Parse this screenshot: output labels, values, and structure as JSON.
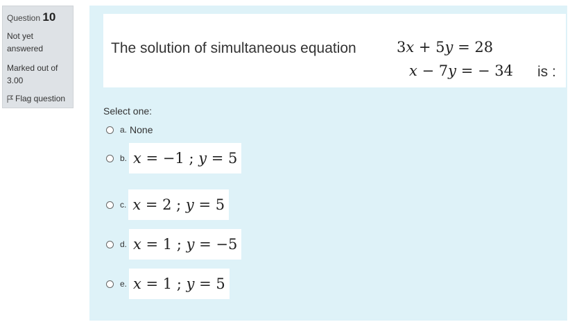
{
  "question_info": {
    "label": "Question",
    "number": "10",
    "state_line1": "Not yet",
    "state_line2": "answered",
    "grade_line1": "Marked out of",
    "grade_line2": "3.00",
    "flag_label": "Flag question",
    "flag_icon": "flag-icon"
  },
  "question": {
    "text": "The solution of simultaneous equation",
    "equation1": "3x + 5y = 28",
    "equation2": "x − 7y = −34",
    "suffix": "is :"
  },
  "answer": {
    "prompt": "Select one:",
    "options": [
      {
        "letter": "a.",
        "text": "None",
        "selected": false
      },
      {
        "letter": "b.",
        "text": "x = −1 ; y = 5",
        "selected": false
      },
      {
        "letter": "c.",
        "text": "x = 2 ; y = 5",
        "selected": false
      },
      {
        "letter": "d.",
        "text": "x = 1 ; y = −5",
        "selected": false
      },
      {
        "letter": "e.",
        "text": "x = 1 ; y = 5",
        "selected": false
      }
    ]
  },
  "colors": {
    "info_panel_bg": "#dee2e6",
    "content_bg": "#def2f8"
  }
}
